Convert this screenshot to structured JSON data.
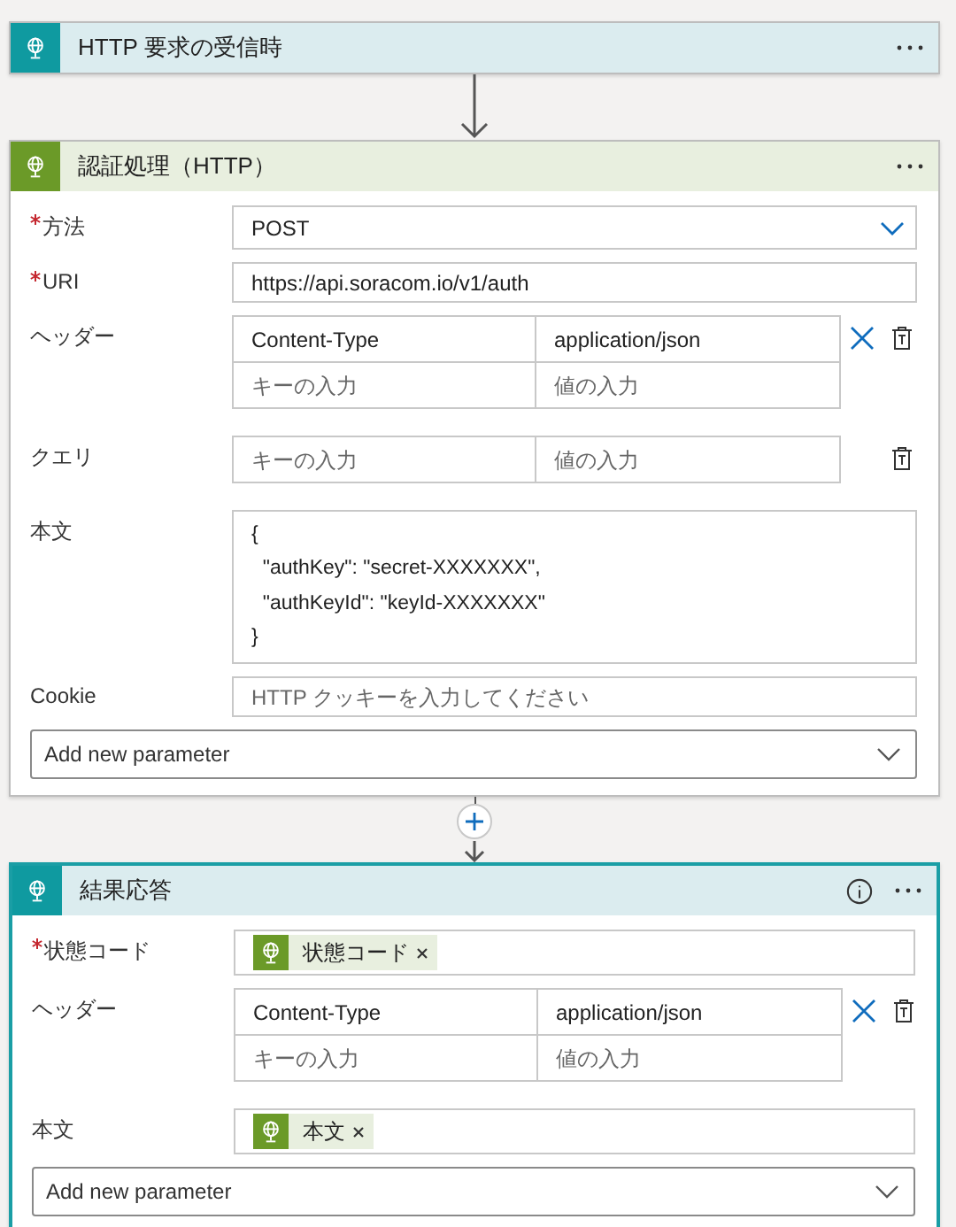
{
  "steps": [
    {
      "kind": "trigger",
      "title": "HTTP 要求の受信時",
      "selected": false,
      "info": false
    },
    {
      "add_button": false,
      "kind": "action",
      "title": "認証処理（HTTP）",
      "selected": false,
      "info": false,
      "fields": [
        {
          "kind": "dropdown",
          "label": "方法",
          "required": true,
          "value": "POST"
        },
        {
          "kind": "text",
          "label": "URI",
          "required": true,
          "value": "https://api.soracom.io/v1/auth"
        },
        {
          "kind": "table",
          "label": "ヘッダー",
          "required": false,
          "rows": [
            {
              "key": "Content-Type",
              "value": "application/json",
              "removable": true
            },
            {
              "key_placeholder": "キーの入力",
              "value_placeholder": "値の入力",
              "removable": false
            }
          ]
        },
        {
          "kind": "table",
          "label": "クエリ",
          "required": false,
          "rows": [
            {
              "key_placeholder": "キーの入力",
              "value_placeholder": "値の入力",
              "removable": false
            }
          ]
        },
        {
          "kind": "multiline",
          "label": "本文",
          "required": false,
          "lines": [
            "{",
            "  \"authKey\": \"secret-XXXXXXX\",",
            "  \"authKeyId\": \"keyId-XXXXXXX\"",
            "}"
          ]
        },
        {
          "kind": "text",
          "label": "Cookie",
          "required": false,
          "placeholder": "HTTP クッキーを入力してください"
        },
        {
          "kind": "add",
          "text": "Add new parameter"
        }
      ]
    },
    {
      "add_button": true,
      "kind": "response",
      "title": "結果応答",
      "selected": true,
      "info": true,
      "fields": [
        {
          "kind": "tokens",
          "label": "状態コード",
          "required": true,
          "tokens": [
            "状態コード"
          ]
        },
        {
          "kind": "table",
          "label": "ヘッダー",
          "required": false,
          "rows": [
            {
              "key": "Content-Type",
              "value": "application/json",
              "removable": true
            },
            {
              "key_placeholder": "キーの入力",
              "value_placeholder": "値の入力",
              "removable": false
            }
          ]
        },
        {
          "kind": "tokens",
          "label": "本文",
          "required": false,
          "tokens": [
            "本文"
          ]
        },
        {
          "kind": "add",
          "text": "Add new parameter"
        }
      ]
    }
  ]
}
